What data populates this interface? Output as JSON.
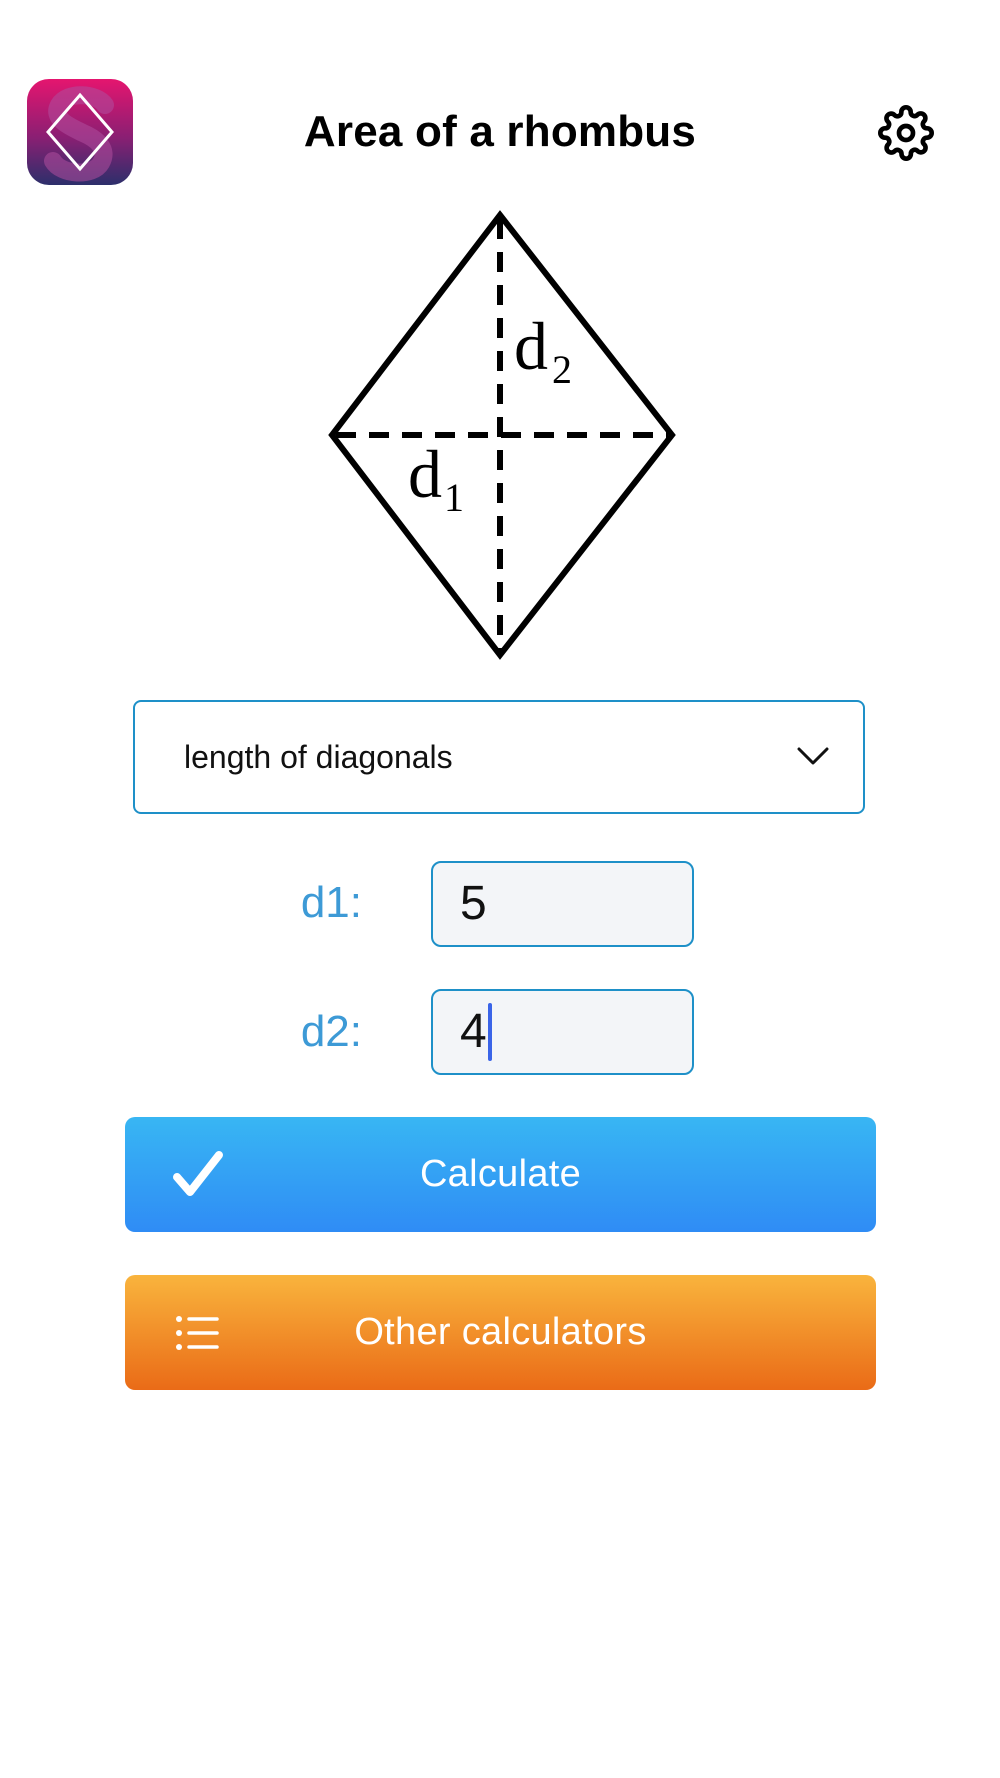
{
  "header": {
    "title": "Area of a rhombus",
    "app_icon": "rhombus-s-logo-icon",
    "settings_icon": "gear-icon"
  },
  "figure": {
    "diagonal_1_label": "d",
    "diagonal_1_subscript": "1",
    "diagonal_2_label": "d",
    "diagonal_2_subscript": "2"
  },
  "mode_select": {
    "selected": "length of diagonals",
    "icon": "chevron-down-icon"
  },
  "fields": [
    {
      "label": "d1:",
      "value": "5"
    },
    {
      "label": "d2:",
      "value": "4"
    }
  ],
  "buttons": {
    "calculate": {
      "label": "Calculate",
      "icon": "checkmark-icon"
    },
    "other": {
      "label": "Other calculators",
      "icon": "list-icon"
    }
  },
  "colors": {
    "accent": "#1e90c8",
    "label_blue": "#3d9ad6",
    "calculate_top": "#38b6f3",
    "calculate_bottom": "#2f8cf5",
    "other_top": "#f9b43d",
    "other_bottom": "#ea6b17",
    "icon_top": "#e5156f",
    "icon_bottom": "#2c2f6b"
  }
}
